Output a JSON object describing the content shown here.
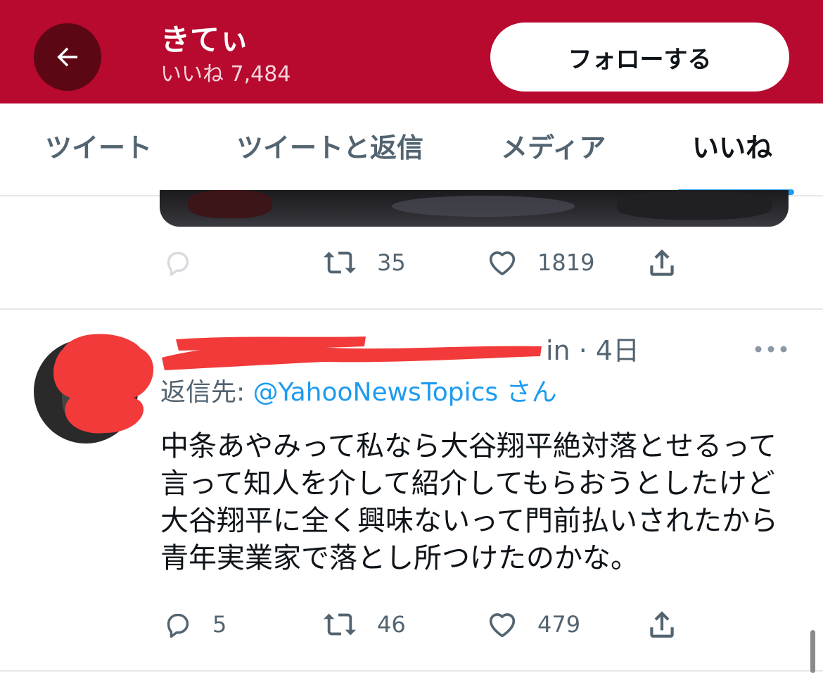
{
  "header": {
    "profile_name": "きてぃ",
    "likes_label": "いいね 7,484",
    "follow_label": "フォローする",
    "colors": {
      "background": "#b8092e",
      "back_button": "#5c0714"
    }
  },
  "tabs": [
    {
      "label": "ツイート",
      "active": false
    },
    {
      "label": "ツイートと返信",
      "active": false
    },
    {
      "label": "メディア",
      "active": false
    },
    {
      "label": "いいね",
      "active": true
    }
  ],
  "previous_tweet": {
    "actions": {
      "reply": "",
      "retweet": "35",
      "like": "1819"
    }
  },
  "tweet": {
    "handle_fragment": "in",
    "time": "4日",
    "reply_prefix": "返信先: ",
    "reply_handle": "@YahooNewsTopics",
    "reply_suffix": "さん",
    "body": "中条あやみって私なら大谷翔平絶対落とせるって言って知人を介して紹介してもらおうとしたけど大谷翔平に全く興味ないって門前払いされたから青年実業家で落とし所つけたのかな。",
    "actions": {
      "reply": "5",
      "retweet": "46",
      "like": "479"
    }
  },
  "icons": [
    "back-arrow-icon",
    "reply-icon",
    "retweet-icon",
    "like-icon",
    "share-icon",
    "more-icon"
  ],
  "colors": {
    "accent": "#1d9bf0",
    "muted": "#536471",
    "redaction": "#f23a3a"
  }
}
